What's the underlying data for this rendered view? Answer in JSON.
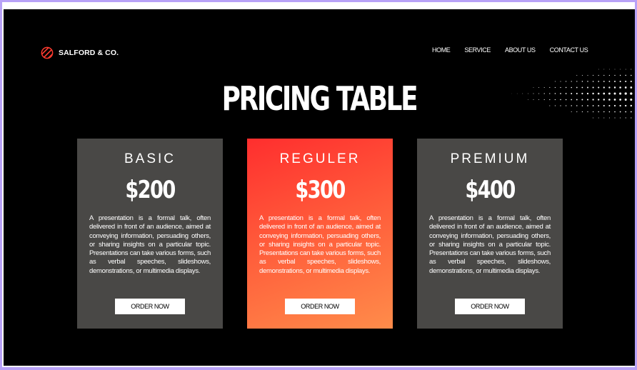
{
  "brand": {
    "name": "SALFORD & CO.",
    "icon": "striped-circle-logo-icon",
    "color": "#ff3b2f"
  },
  "nav": {
    "items": [
      "HOME",
      "SERVICE",
      "ABOUT US",
      "CONTACT US"
    ]
  },
  "title": "PRICING TABLE",
  "plans": [
    {
      "name": "BASIC",
      "price": "$200",
      "description": "A presentation is a formal talk, often delivered in front of an audience, aimed at conveying information, persuading others, or sharing insights on a particular topic. Presentations can take various forms, such as verbal speeches, slideshows, demonstrations, or multimedia displays.",
      "button": "ORDER NOW",
      "color": "#494846"
    },
    {
      "name": "REGULER",
      "price": "$300",
      "description": "A presentation is a formal talk, often delivered in front of an audience, aimed at conveying information, persuading others, or sharing insights on a particular topic. Presentations can take various forms, such as verbal speeches, slideshows, demonstrations, or multimedia displays.",
      "button": "ORDER NOW",
      "color": "#ff4a35"
    },
    {
      "name": "PREMIUM",
      "price": "$400",
      "description": "A presentation is a formal talk, often delivered in front of an audience, aimed at conveying information, persuading others, or sharing insights on a particular topic. Presentations can take various forms, such as verbal speeches, slideshows, demonstrations, or multimedia displays.",
      "button": "ORDER NOW",
      "color": "#494846"
    }
  ]
}
